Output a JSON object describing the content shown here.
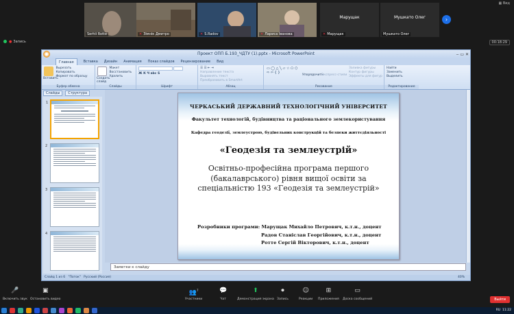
{
  "participants": [
    {
      "name": "Serhii Rotte",
      "muted": false,
      "video": true
    },
    {
      "name": "Зімнік Дмитро",
      "muted": true,
      "video": true
    },
    {
      "name": "S.Radov",
      "muted": true,
      "video": true
    },
    {
      "name": "Лариса Іванова",
      "muted": true,
      "video": true
    },
    {
      "name": "Марущак",
      "muted": true,
      "video": false
    },
    {
      "name": "Мушкато Олег",
      "muted": true,
      "video": false
    }
  ],
  "dark_tiles": [
    {
      "center": "Марущак",
      "label": "Марущак"
    },
    {
      "center": "Мушкато Олег",
      "label": "Мушкато Олег"
    }
  ],
  "recording_label": "Запись",
  "clock": "00:18:29",
  "view_label": "Вид",
  "ppt": {
    "window_title": "Проект ОПП Б.193_ЧДТУ (1).pptx - Microsoft PowerPoint",
    "tabs": [
      "Главная",
      "Вставка",
      "Дизайн",
      "Анимация",
      "Показ слайдов",
      "Рецензирование",
      "Вид"
    ],
    "ribbon": {
      "clipboard": {
        "paste": "Вставить",
        "cut": "Вырезать",
        "copy": "Копировать",
        "format": "Формат по образцу",
        "label": "Буфер обмена"
      },
      "slides": {
        "new": "Создать слайд",
        "layout": "Макет",
        "reset": "Восстановить",
        "delete": "Удалить",
        "label": "Слайды"
      },
      "font": {
        "label": "Шрифт"
      },
      "paragraph": {
        "direction": "Направление текста",
        "align": "Выровнять текст",
        "smartart": "Преобразовать в SmartArt",
        "label": "Абзац"
      },
      "drawing": {
        "arrange": "Упорядочить",
        "styles": "Экспресс-стили",
        "fill": "Заливка фигуры",
        "outline": "Контур фигуры",
        "effects": "Эффекты для фигур",
        "label": "Рисование"
      },
      "editing": {
        "find": "Найти",
        "replace": "Заменить",
        "select": "Выделить",
        "label": "Редактирование"
      }
    },
    "left_tabs": [
      "Слайды",
      "Структура"
    ],
    "thumb_numbers": [
      "1",
      "2",
      "3",
      "4"
    ],
    "slide": {
      "university": "ЧЕРКАСЬКИЙ ДЕРЖАВНИЙ ТЕХНОЛОГІЧНИЙ УНІВЕРСИТЕТ",
      "faculty": "Факультет технологій, будівництва та раціонального землекористування",
      "department": "Кафедра геодезії, землеустрою, будівельних конструкцій та безпеки життєдіяльності",
      "program_title": "«Геодезія та землеустрій»",
      "program_description": "Освітньо-професійна програма першого (бакалаврського) рівня вищої освіти за спеціальністю 193 «Геодезія та землеустрій»",
      "developers_label": "Розробники програми:",
      "developers": [
        "Марущак Михайло Петрович, к.т.н., доцент",
        "Радов Станіслав Георгійович, к.т.н., доцент",
        "Ротте Сергій Вікторович, к.т.н., доцент"
      ]
    },
    "notes_placeholder": "Заметки к слайду",
    "status": {
      "slide": "Слайд 1 из 6",
      "theme": "\"Поток\"",
      "lang": "Русский (Россия)",
      "zoom": "40%"
    }
  },
  "bottom_bar": [
    {
      "label": "Включить звук",
      "icon": "mic-off-icon"
    },
    {
      "label": "Остановить видео",
      "icon": "video-icon"
    },
    {
      "label": "Участники",
      "icon": "participants-icon",
      "badge": "7"
    },
    {
      "label": "Чат",
      "icon": "chat-icon"
    },
    {
      "label": "Демонстрация экрана",
      "icon": "share-screen-icon"
    },
    {
      "label": "Запись",
      "icon": "record-icon"
    },
    {
      "label": "Реакции",
      "icon": "reactions-icon"
    },
    {
      "label": "Приложения",
      "icon": "apps-icon"
    },
    {
      "label": "Доска сообщений",
      "icon": "whiteboard-icon"
    }
  ],
  "leave_label": "Выйти",
  "system_tray": {
    "lang": "RU",
    "time": "11:22"
  },
  "colors": {
    "accent": "#1d6fe8",
    "leave": "#e03131",
    "share": "#22c55e"
  }
}
